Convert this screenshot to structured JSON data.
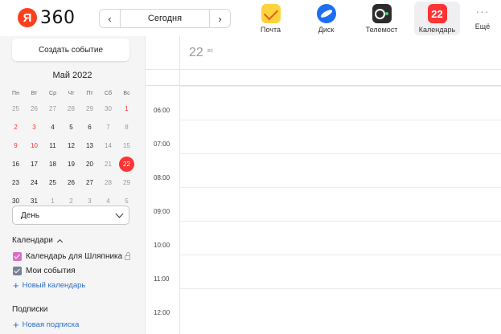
{
  "header": {
    "logo_letter": "Я",
    "logo_text": "360",
    "date_nav": {
      "prev_icon": "‹",
      "next_icon": "›",
      "today_label": "Сегодня"
    },
    "apps": [
      {
        "label": "Почта",
        "icon": "mail-icon"
      },
      {
        "label": "Диск",
        "icon": "disk-icon"
      },
      {
        "label": "Телемост",
        "icon": "telemost-icon"
      },
      {
        "label": "Календарь",
        "icon": "calendar-icon",
        "icon_text": "22",
        "active": true
      }
    ],
    "more": {
      "dots": "···",
      "label": "Ещё"
    }
  },
  "sidebar": {
    "create_button": "Создать событие",
    "mini_calendar": {
      "title": "Май 2022",
      "weekdays": [
        "Пн",
        "Вт",
        "Ср",
        "Чт",
        "Пт",
        "Сб",
        "Вс"
      ],
      "weeks": [
        [
          "25",
          "26",
          "27",
          "28",
          "29",
          "30",
          "1"
        ],
        [
          "2",
          "3",
          "4",
          "5",
          "6",
          "7",
          "8"
        ],
        [
          "9",
          "10",
          "11",
          "12",
          "13",
          "14",
          "15"
        ],
        [
          "16",
          "17",
          "18",
          "19",
          "20",
          "21",
          "22"
        ],
        [
          "23",
          "24",
          "25",
          "26",
          "27",
          "28",
          "29"
        ],
        [
          "30",
          "31",
          "1",
          "2",
          "3",
          "4",
          "5"
        ]
      ],
      "selected_day": "22"
    },
    "view_select": {
      "value": "День"
    },
    "calendars_title": "Календари",
    "calendars": [
      {
        "label": "Календарь для Шляпника",
        "color": "#d86fc5"
      },
      {
        "label": "Мои события",
        "color": "#7a7f99"
      }
    ],
    "new_calendar": "Новый календарь",
    "subscriptions_title": "Подписки",
    "new_subscription": "Новая подписка"
  },
  "main": {
    "day_number": "22",
    "day_weekday": "вс",
    "hours": [
      "06:00",
      "07:00",
      "08:00",
      "09:00",
      "10:00",
      "11:00",
      "12:00"
    ]
  },
  "colors": {
    "accent_red": "#ff3333",
    "link_blue": "#2d6fc8",
    "sidebar_bg": "#f5f5f6"
  }
}
